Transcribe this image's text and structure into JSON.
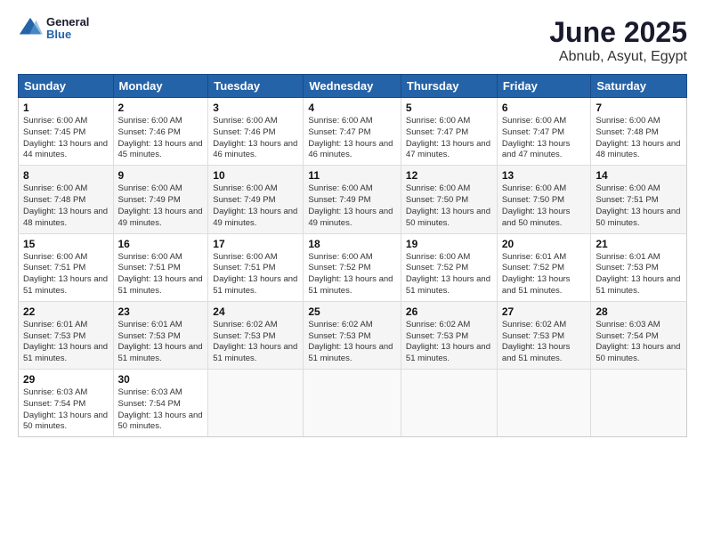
{
  "header": {
    "logo_general": "General",
    "logo_blue": "Blue",
    "title": "June 2025",
    "subtitle": "Abnub, Asyut, Egypt"
  },
  "days_of_week": [
    "Sunday",
    "Monday",
    "Tuesday",
    "Wednesday",
    "Thursday",
    "Friday",
    "Saturday"
  ],
  "weeks": [
    [
      {
        "day": "1",
        "sunrise": "6:00 AM",
        "sunset": "7:45 PM",
        "daylight": "13 hours and 44 minutes."
      },
      {
        "day": "2",
        "sunrise": "6:00 AM",
        "sunset": "7:46 PM",
        "daylight": "13 hours and 45 minutes."
      },
      {
        "day": "3",
        "sunrise": "6:00 AM",
        "sunset": "7:46 PM",
        "daylight": "13 hours and 46 minutes."
      },
      {
        "day": "4",
        "sunrise": "6:00 AM",
        "sunset": "7:47 PM",
        "daylight": "13 hours and 46 minutes."
      },
      {
        "day": "5",
        "sunrise": "6:00 AM",
        "sunset": "7:47 PM",
        "daylight": "13 hours and 47 minutes."
      },
      {
        "day": "6",
        "sunrise": "6:00 AM",
        "sunset": "7:47 PM",
        "daylight": "13 hours and 47 minutes."
      },
      {
        "day": "7",
        "sunrise": "6:00 AM",
        "sunset": "7:48 PM",
        "daylight": "13 hours and 48 minutes."
      }
    ],
    [
      {
        "day": "8",
        "sunrise": "6:00 AM",
        "sunset": "7:48 PM",
        "daylight": "13 hours and 48 minutes."
      },
      {
        "day": "9",
        "sunrise": "6:00 AM",
        "sunset": "7:49 PM",
        "daylight": "13 hours and 49 minutes."
      },
      {
        "day": "10",
        "sunrise": "6:00 AM",
        "sunset": "7:49 PM",
        "daylight": "13 hours and 49 minutes."
      },
      {
        "day": "11",
        "sunrise": "6:00 AM",
        "sunset": "7:49 PM",
        "daylight": "13 hours and 49 minutes."
      },
      {
        "day": "12",
        "sunrise": "6:00 AM",
        "sunset": "7:50 PM",
        "daylight": "13 hours and 50 minutes."
      },
      {
        "day": "13",
        "sunrise": "6:00 AM",
        "sunset": "7:50 PM",
        "daylight": "13 hours and 50 minutes."
      },
      {
        "day": "14",
        "sunrise": "6:00 AM",
        "sunset": "7:51 PM",
        "daylight": "13 hours and 50 minutes."
      }
    ],
    [
      {
        "day": "15",
        "sunrise": "6:00 AM",
        "sunset": "7:51 PM",
        "daylight": "13 hours and 51 minutes."
      },
      {
        "day": "16",
        "sunrise": "6:00 AM",
        "sunset": "7:51 PM",
        "daylight": "13 hours and 51 minutes."
      },
      {
        "day": "17",
        "sunrise": "6:00 AM",
        "sunset": "7:51 PM",
        "daylight": "13 hours and 51 minutes."
      },
      {
        "day": "18",
        "sunrise": "6:00 AM",
        "sunset": "7:52 PM",
        "daylight": "13 hours and 51 minutes."
      },
      {
        "day": "19",
        "sunrise": "6:00 AM",
        "sunset": "7:52 PM",
        "daylight": "13 hours and 51 minutes."
      },
      {
        "day": "20",
        "sunrise": "6:01 AM",
        "sunset": "7:52 PM",
        "daylight": "13 hours and 51 minutes."
      },
      {
        "day": "21",
        "sunrise": "6:01 AM",
        "sunset": "7:53 PM",
        "daylight": "13 hours and 51 minutes."
      }
    ],
    [
      {
        "day": "22",
        "sunrise": "6:01 AM",
        "sunset": "7:53 PM",
        "daylight": "13 hours and 51 minutes."
      },
      {
        "day": "23",
        "sunrise": "6:01 AM",
        "sunset": "7:53 PM",
        "daylight": "13 hours and 51 minutes."
      },
      {
        "day": "24",
        "sunrise": "6:02 AM",
        "sunset": "7:53 PM",
        "daylight": "13 hours and 51 minutes."
      },
      {
        "day": "25",
        "sunrise": "6:02 AM",
        "sunset": "7:53 PM",
        "daylight": "13 hours and 51 minutes."
      },
      {
        "day": "26",
        "sunrise": "6:02 AM",
        "sunset": "7:53 PM",
        "daylight": "13 hours and 51 minutes."
      },
      {
        "day": "27",
        "sunrise": "6:02 AM",
        "sunset": "7:53 PM",
        "daylight": "13 hours and 51 minutes."
      },
      {
        "day": "28",
        "sunrise": "6:03 AM",
        "sunset": "7:54 PM",
        "daylight": "13 hours and 50 minutes."
      }
    ],
    [
      {
        "day": "29",
        "sunrise": "6:03 AM",
        "sunset": "7:54 PM",
        "daylight": "13 hours and 50 minutes."
      },
      {
        "day": "30",
        "sunrise": "6:03 AM",
        "sunset": "7:54 PM",
        "daylight": "13 hours and 50 minutes."
      },
      {
        "day": "",
        "sunrise": "",
        "sunset": "",
        "daylight": ""
      },
      {
        "day": "",
        "sunrise": "",
        "sunset": "",
        "daylight": ""
      },
      {
        "day": "",
        "sunrise": "",
        "sunset": "",
        "daylight": ""
      },
      {
        "day": "",
        "sunrise": "",
        "sunset": "",
        "daylight": ""
      },
      {
        "day": "",
        "sunrise": "",
        "sunset": "",
        "daylight": ""
      }
    ]
  ]
}
